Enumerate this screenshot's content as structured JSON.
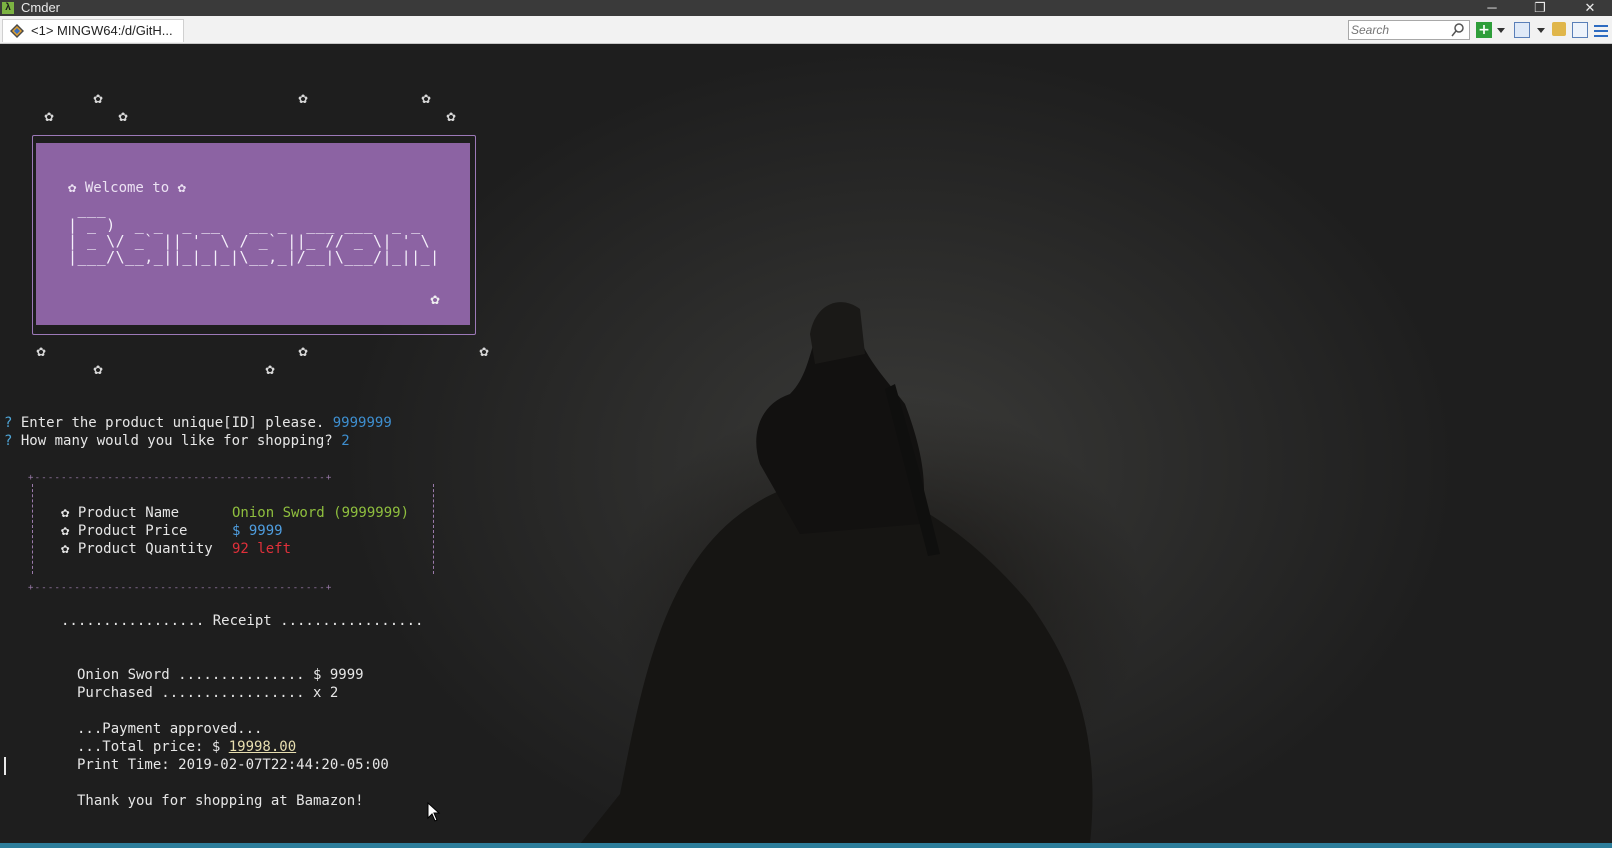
{
  "window": {
    "title": "Cmder",
    "icon": "lambda-icon"
  },
  "tabbar": {
    "tab_label": "<1> MINGW64:/d/GitH...",
    "search_placeholder": "Search"
  },
  "banner": {
    "welcome": "✿ Welcome to ✿",
    "ascii": [
      " ___",
      "| _ )  _ _  _ __   __ _  ___ ___  _ _",
      "| _ \\/ _` || '  \\ / _` ||_ // _ \\| ' \\",
      "|___/\\__,_||_|_|_|\\__,_|/__|\\___/|_||_|"
    ]
  },
  "prompts": [
    {
      "mark": "?",
      "question": "Enter the product unique[ID] please.",
      "answer": "9999999"
    },
    {
      "mark": "?",
      "question": "How many would you like for shopping?",
      "answer": "2"
    }
  ],
  "product_box": {
    "border_top": "+--------------------------------------------+",
    "border_bottom": "+--------------------------------------------+",
    "rows": [
      {
        "label": "✿ Product Name",
        "value": "Onion Sword (9999999)"
      },
      {
        "label": "✿ Product Price",
        "value": "$ 9999"
      },
      {
        "label": "✿ Product Quantity",
        "value": "92 left"
      }
    ]
  },
  "receipt": {
    "header": "................. Receipt .................",
    "item_line": "Onion Sword ............... $ 9999",
    "purchased_line": "Purchased ................. x 2",
    "payment": "...Payment approved...",
    "total_prefix": "...Total price: $ ",
    "total_value": "19998.00",
    "print_time": "Print Time: 2019-02-07T22:44:20-05:00",
    "thanks": "Thank you for shopping at Bamazon!"
  },
  "colors": {
    "banner_bg": "#8c63a3",
    "answer": "#3e8fd0",
    "product_name": "#8fbf3e",
    "product_price": "#4f9ee0",
    "product_quantity": "#e0303a",
    "status_bar": "#2d7d9a"
  }
}
